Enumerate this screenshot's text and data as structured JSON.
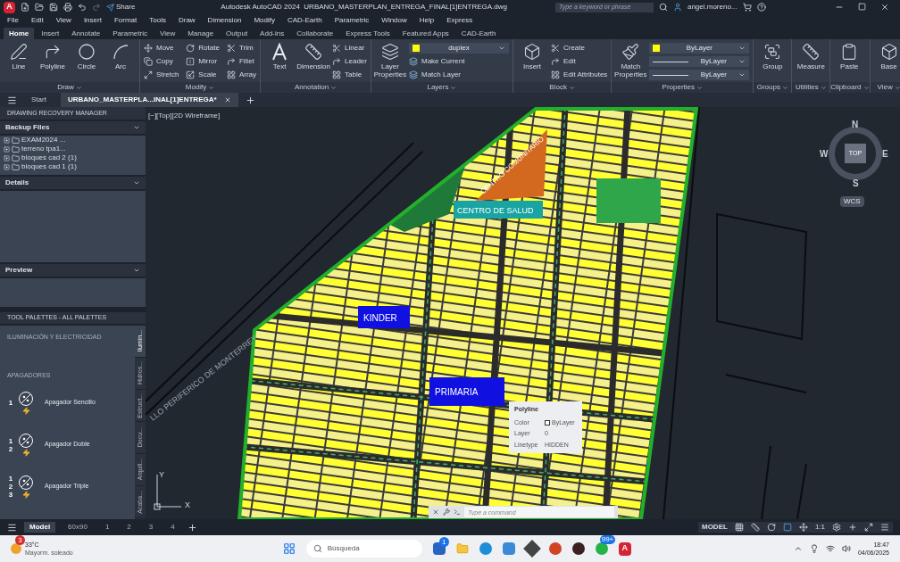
{
  "title_bar": {
    "logo": "A",
    "share": "Share",
    "app": "Autodesk AutoCAD 2024",
    "file": "URBANO_MASTERPLAN_ENTREGA_FINAL[1]ENTREGA.dwg",
    "search_placeholder": "Type a keyword or phrase",
    "user": "angel.moreno..."
  },
  "menu": [
    "File",
    "Edit",
    "View",
    "Insert",
    "Format",
    "Tools",
    "Draw",
    "Dimension",
    "Modify",
    "CAD-Earth",
    "Parametric",
    "Window",
    "Help",
    "Express"
  ],
  "ribbon_tabs": [
    {
      "label": "Home",
      "selected": true
    },
    {
      "label": "Insert",
      "selected": false
    },
    {
      "label": "Annotate",
      "selected": false
    },
    {
      "label": "Parametric",
      "selected": false
    },
    {
      "label": "View",
      "selected": false
    },
    {
      "label": "Manage",
      "selected": false
    },
    {
      "label": "Output",
      "selected": false
    },
    {
      "label": "Add-ins",
      "selected": false
    },
    {
      "label": "Collaborate",
      "selected": false
    },
    {
      "label": "Express Tools",
      "selected": false
    },
    {
      "label": "Featured Apps",
      "selected": false
    },
    {
      "label": "CAD-Earth",
      "selected": false
    }
  ],
  "ribbon_groups": [
    {
      "title": "Draw",
      "large": [
        "Line",
        "Polyline",
        "Circle",
        "Arc"
      ]
    },
    {
      "title": "Modify",
      "small": [
        "Move",
        "Copy",
        "Stretch",
        "Rotate",
        "Mirror",
        "Scale",
        "Trim",
        "Fillet",
        "Array"
      ]
    },
    {
      "title": "Annotation",
      "large": [
        "Text",
        "Dimension"
      ],
      "small": [
        "Linear",
        "Leader",
        "Table"
      ]
    },
    {
      "title": "Layers",
      "large": [
        "Layer Properties"
      ],
      "small": [
        "Make Current",
        "Match Layer"
      ],
      "dropdowns": [
        "duplex"
      ]
    },
    {
      "title": "Block",
      "large": [
        "Insert"
      ],
      "small": [
        "Create",
        "Edit",
        "Edit Attributes"
      ]
    },
    {
      "title": "Properties",
      "large": [
        "Match Properties"
      ],
      "dropdowns": [
        "ByLayer",
        "ByLayer",
        "ByLayer"
      ]
    },
    {
      "title": "Groups",
      "large": [
        "Group"
      ]
    },
    {
      "title": "Utilities",
      "large": [
        "Measure"
      ]
    },
    {
      "title": "Clipboard",
      "large": [
        "Paste"
      ]
    },
    {
      "title": "View",
      "large": [
        "Base"
      ]
    }
  ],
  "file_tabs": [
    {
      "label": "Start",
      "selected": false
    },
    {
      "label": "URBANO_MASTERPLA...INAL[1]ENTREGA*",
      "selected": true
    }
  ],
  "recovery_manager": {
    "title": "DRAWING RECOVERY MANAGER",
    "backup_title": "Backup Files",
    "files": [
      "EXAM2024 ...",
      "terreno tpa1...",
      "bloques cad 2 (1)",
      "bloques cad 1 (1)"
    ],
    "details_title": "Details",
    "preview_title": "Preview"
  },
  "tool_palettes": {
    "title": "TOOL PALETTES - ALL PALETTES",
    "palette": "ILUMINACIÓN Y ELECTRICIDAD",
    "section": "APAGADORES",
    "items": [
      {
        "numbers": [
          "1"
        ],
        "label": "Apagador Sencillo"
      },
      {
        "numbers": [
          "1",
          "2"
        ],
        "label": "Apagador Doble"
      },
      {
        "numbers": [
          "1",
          "2",
          "3"
        ],
        "label": "Apagador Triple"
      }
    ],
    "side_tabs": [
      {
        "label": "Ilumin...",
        "selected": true
      },
      {
        "label": "Hidros...",
        "selected": false
      },
      {
        "label": "Estruct...",
        "selected": false
      },
      {
        "label": "Docu...",
        "selected": false
      },
      {
        "label": "Arquit...",
        "selected": false
      },
      {
        "label": "Acaba...",
        "selected": false
      }
    ]
  },
  "viewport": {
    "label": "[−][Top][2D Wireframe]",
    "compass": {
      "north": "N",
      "east": "E",
      "south": "S",
      "west": "W"
    },
    "cube_face": "TOP",
    "ucs_name": "WCS",
    "axis_x": "X",
    "axis_y": "Y"
  },
  "drawing_labels": {
    "kinder": "KINDER",
    "primaria": "PRIMARIA",
    "salud": "CENTRO DE SALUD",
    "comunitario": "CENTRO COMUNITARIO",
    "road": "LLO PERIFERICO DE MONTERREY"
  },
  "tooltip": {
    "title": "Polyline",
    "rows": [
      {
        "key": "Color",
        "value": "ByLayer"
      },
      {
        "key": "Layer",
        "value": "0"
      },
      {
        "key": "Linetype",
        "value": "HIDDEN"
      }
    ]
  },
  "command_line": {
    "placeholder": "Type a command"
  },
  "layout_tabs": [
    {
      "label": "Model",
      "selected": true
    },
    {
      "label": "60x90",
      "selected": false
    },
    {
      "label": "1",
      "selected": false
    },
    {
      "label": "2",
      "selected": false
    },
    {
      "label": "3",
      "selected": false
    },
    {
      "label": "4",
      "selected": false
    }
  ],
  "status_bar": {
    "space": "MODEL",
    "scale": "1:1"
  },
  "taskbar": {
    "weather_badge": "3",
    "temperature": "33°C",
    "weather": "Mayorm. soleado",
    "search": "Búsqueda",
    "store_badge": "1",
    "whatsapp_badge": "99+",
    "autocad_logo": "A",
    "time": "18:47",
    "date": "04/06/2025"
  }
}
